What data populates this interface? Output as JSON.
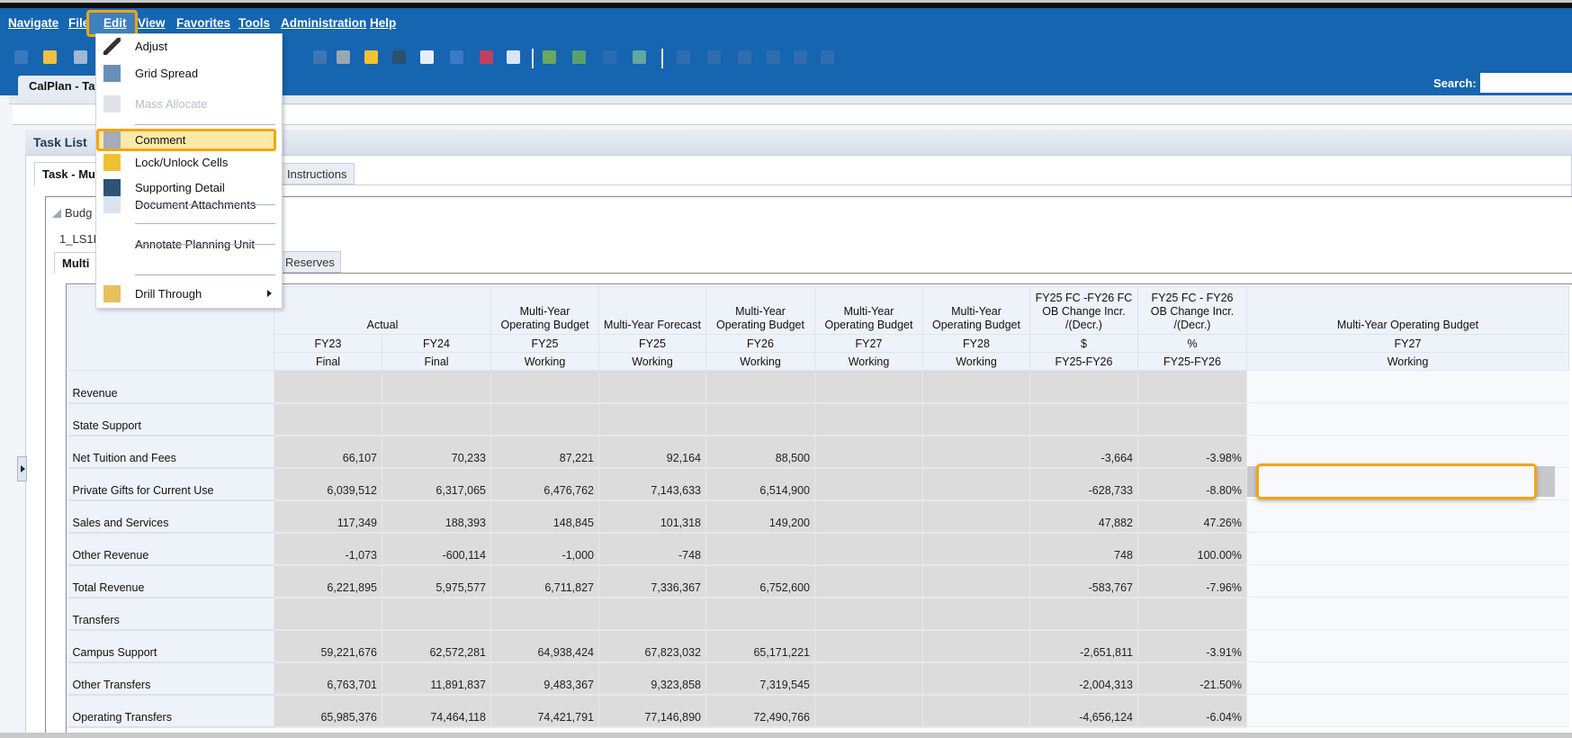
{
  "menubar": {
    "items": [
      "Navigate",
      "File",
      "Edit",
      "View",
      "Favorites",
      "Tools",
      "Administration",
      "Help"
    ]
  },
  "app_tab": "CalPlan - Ta",
  "search": {
    "label": "Search:",
    "value": ""
  },
  "task_list": {
    "title": "Task List"
  },
  "task_tab": "Task - Mu",
  "instructions_tab": "Instructions",
  "budget_label": "Budg",
  "pov_label": "1_LS1F",
  "form_tab": "Multi",
  "reserves_tab": "Reserves",
  "edit_menu": {
    "items": [
      {
        "label": "Adjust",
        "icon": "pencil-icon",
        "disabled": false
      },
      {
        "label": "Grid Spread",
        "icon": "grid-spread-icon",
        "disabled": false
      },
      {
        "label": "Mass Allocate",
        "icon": "mass-allocate-icon",
        "disabled": true
      },
      {
        "label": "Comment",
        "icon": "comment-icon",
        "disabled": false,
        "highlighted": true
      },
      {
        "label": "Lock/Unlock Cells",
        "icon": "lock-icon",
        "disabled": false
      },
      {
        "label": "Supporting Detail",
        "icon": "supporting-detail-icon",
        "disabled": false
      },
      {
        "label": "Document Attachments",
        "icon": "attachment-icon",
        "disabled": false
      },
      {
        "label": "Annotate Planning Unit",
        "icon": "",
        "disabled": false
      },
      {
        "label": "Drill Through",
        "icon": "drill-through-icon",
        "disabled": false,
        "submenu": true
      }
    ]
  },
  "grid": {
    "header_row1": [
      "Actual",
      "Multi-Year Operating Budget",
      "Multi-Year Forecast",
      "Multi-Year Operating Budget",
      "Multi-Year Operating Budget",
      "Multi-Year Operating Budget",
      "FY25 FC -FY26 FC OB Change Incr. /(Decr.)",
      "FY25 FC - FY26 OB Change Incr. /(Decr.)",
      "Multi-Year Operating Budget"
    ],
    "header_row2": [
      "FY23",
      "FY24",
      "FY25",
      "FY25",
      "FY26",
      "FY27",
      "FY28",
      "$",
      "%",
      "FY27"
    ],
    "header_row3": [
      "Final",
      "Final",
      "Working",
      "Working",
      "Working",
      "Working",
      "Working",
      "FY25-FY26",
      "FY25-FY26",
      "Working"
    ],
    "rows": [
      {
        "label": "Revenue",
        "values": [
          "",
          "",
          "",
          "",
          "",
          "",
          "",
          "",
          "",
          ""
        ]
      },
      {
        "label": "State Support",
        "values": [
          "",
          "",
          "",
          "",
          "",
          "",
          "",
          "",
          "",
          ""
        ]
      },
      {
        "label": "Net Tuition and Fees",
        "values": [
          "66,107",
          "70,233",
          "87,221",
          "92,164",
          "88,500",
          "",
          "",
          "-3,664",
          "-3.98%",
          ""
        ]
      },
      {
        "label": "Private Gifts for Current Use",
        "values": [
          "6,039,512",
          "6,317,065",
          "6,476,762",
          "7,143,633",
          "6,514,900",
          "",
          "",
          "-628,733",
          "-8.80%",
          ""
        ]
      },
      {
        "label": "Sales and Services",
        "values": [
          "117,349",
          "188,393",
          "148,845",
          "101,318",
          "149,200",
          "",
          "",
          "47,882",
          "47.26%",
          ""
        ]
      },
      {
        "label": "Other Revenue",
        "values": [
          "-1,073",
          "-600,114",
          "-1,000",
          "-748",
          "",
          "",
          "",
          "748",
          "100.00%",
          ""
        ]
      },
      {
        "label": "Total Revenue",
        "values": [
          "6,221,895",
          "5,975,577",
          "6,711,827",
          "7,336,367",
          "6,752,600",
          "",
          "",
          "-583,767",
          "-7.96%",
          ""
        ]
      },
      {
        "label": "Transfers",
        "values": [
          "",
          "",
          "",
          "",
          "",
          "",
          "",
          "",
          "",
          ""
        ]
      },
      {
        "label": "Campus Support",
        "values": [
          "59,221,676",
          "62,572,281",
          "64,938,424",
          "67,823,032",
          "65,171,221",
          "",
          "",
          "-2,651,811",
          "-3.91%",
          ""
        ]
      },
      {
        "label": "Other Transfers",
        "values": [
          "6,763,701",
          "11,891,837",
          "9,483,367",
          "9,323,858",
          "7,319,545",
          "",
          "",
          "-2,004,313",
          "-21.50%",
          ""
        ]
      },
      {
        "label": "Operating Transfers",
        "values": [
          "65,985,376",
          "74,464,118",
          "74,421,791",
          "77,146,890",
          "72,490,766",
          "",
          "",
          "-4,656,124",
          "-6.04%",
          ""
        ]
      }
    ]
  },
  "colors": {
    "header_blue": "#1565b0",
    "highlight_orange": "#f5a50a",
    "readonly_cell": "#dcdcdc",
    "editable_cell": "#f7f9fd"
  }
}
